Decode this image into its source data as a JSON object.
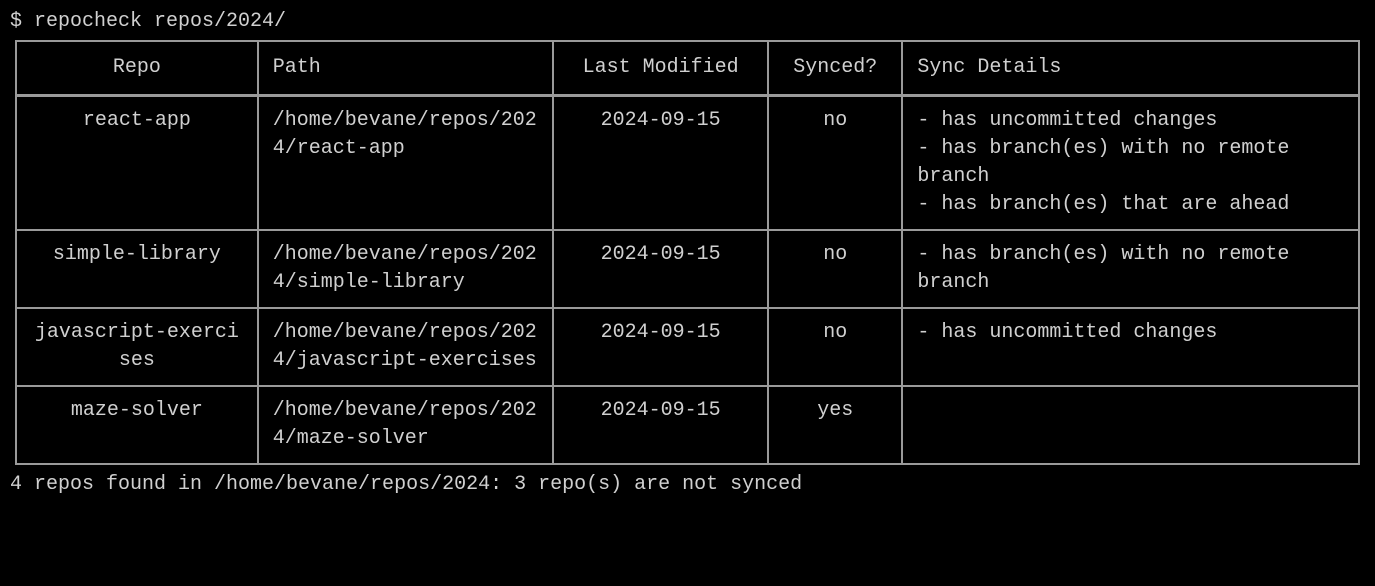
{
  "command": {
    "prompt": "$ ",
    "text": "repocheck repos/2024/"
  },
  "table": {
    "headers": {
      "repo": "Repo",
      "path": "Path",
      "modified": "Last Modified",
      "synced": "Synced?",
      "details": "Sync Details"
    },
    "rows": [
      {
        "repo": "react-app",
        "path": "/home/bevane/repos/2024/react-app",
        "modified": "2024-09-15",
        "synced": "no",
        "details": "- has uncommitted changes\n- has branch(es) with no remote branch\n- has branch(es) that are ahead"
      },
      {
        "repo": "simple-library",
        "path": "/home/bevane/repos/2024/simple-library",
        "modified": "2024-09-15",
        "synced": "no",
        "details": "- has branch(es) with no remote branch"
      },
      {
        "repo": "javascript-exercises",
        "path": "/home/bevane/repos/2024/javascript-exercises",
        "modified": "2024-09-15",
        "synced": "no",
        "details": "- has uncommitted changes"
      },
      {
        "repo": "maze-solver",
        "path": "/home/bevane/repos/2024/maze-solver",
        "modified": "2024-09-15",
        "synced": "yes",
        "details": ""
      }
    ]
  },
  "summary": "4 repos found in /home/bevane/repos/2024: 3 repo(s) are not synced"
}
